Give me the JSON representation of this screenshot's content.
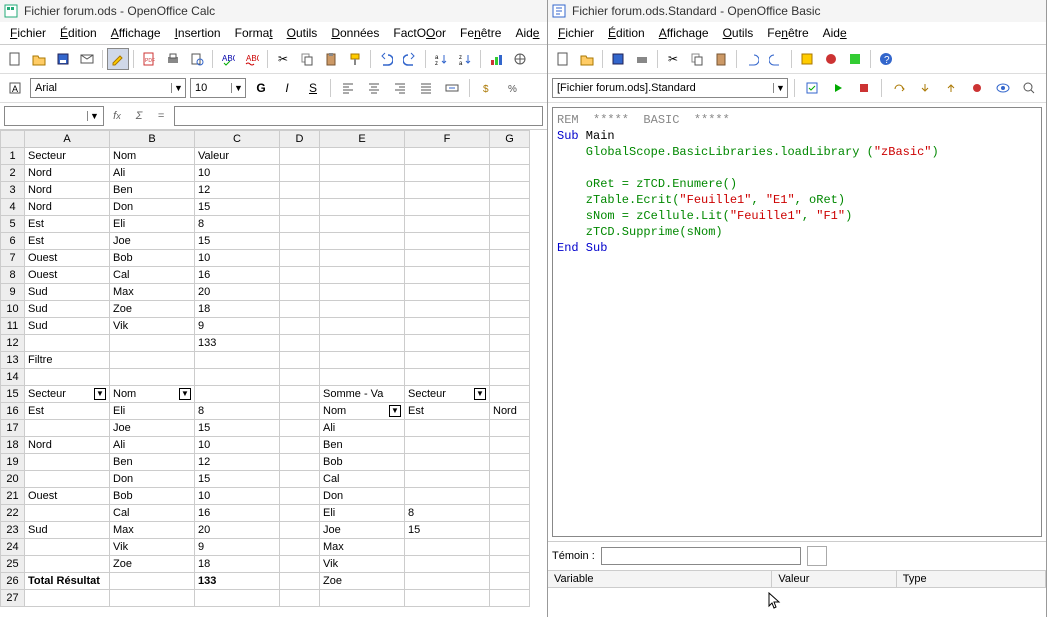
{
  "calc": {
    "title": "Fichier forum.ods - OpenOffice Calc",
    "menus": [
      "Fichier",
      "Édition",
      "Affichage",
      "Insertion",
      "Format",
      "Outils",
      "Données",
      "FactOOor",
      "Fenêtre",
      "Aide"
    ],
    "font_name": "Arial",
    "font_size": "10",
    "style_btns": {
      "bold": "G",
      "italic": "I",
      "underline": "S"
    },
    "cell_ref": "",
    "cols": [
      "A",
      "B",
      "C",
      "D",
      "E",
      "F",
      "G"
    ],
    "rows": [
      {
        "n": 1,
        "A": "Secteur",
        "B": "Nom",
        "C": "Valeur"
      },
      {
        "n": 2,
        "A": "Nord",
        "B": "Ali",
        "Cnum": "10"
      },
      {
        "n": 3,
        "A": "Nord",
        "B": "Ben",
        "Cnum": "12"
      },
      {
        "n": 4,
        "A": "Nord",
        "B": "Don",
        "Cnum": "15"
      },
      {
        "n": 5,
        "A": "Est",
        "B": "Eli",
        "Cnum": "8"
      },
      {
        "n": 6,
        "A": "Est",
        "B": "Joe",
        "Cnum": "15"
      },
      {
        "n": 7,
        "A": "Ouest",
        "B": "Bob",
        "Cnum": "10"
      },
      {
        "n": 8,
        "A": "Ouest",
        "B": "Cal",
        "Cnum": "16"
      },
      {
        "n": 9,
        "A": "Sud",
        "B": "Max",
        "Cnum": "20"
      },
      {
        "n": 10,
        "A": "Sud",
        "B": "Zoe",
        "Cnum": "18"
      },
      {
        "n": 11,
        "A": "Sud",
        "B": "Vik",
        "Cnum": "9"
      },
      {
        "n": 12,
        "Cnum": "133"
      },
      {
        "n": 13,
        "A": "Filtre"
      },
      {
        "n": 14
      },
      {
        "n": 15,
        "A": "Secteur",
        "Afilter": true,
        "B": "Nom",
        "Bfilter": true,
        "E": "Somme - Va",
        "F": "Secteur",
        "Ffilter": true,
        "borderEF": true
      },
      {
        "n": 16,
        "A": "Est",
        "B": "Eli",
        "Cnum": "8",
        "E": "Nom",
        "Efilter": true,
        "F": "Est",
        "G": "Nord",
        "borderEF": true
      },
      {
        "n": 17,
        "B": "Joe",
        "Cnum": "15",
        "E": "Ali",
        "borderEF": true
      },
      {
        "n": 18,
        "A": "Nord",
        "B": "Ali",
        "Cnum": "10",
        "E": "Ben",
        "borderEF": true
      },
      {
        "n": 19,
        "B": "Ben",
        "Cnum": "12",
        "E": "Bob",
        "borderEF": true
      },
      {
        "n": 20,
        "B": "Don",
        "Cnum": "15",
        "E": "Cal",
        "borderEF": true
      },
      {
        "n": 21,
        "A": "Ouest",
        "B": "Bob",
        "Cnum": "10",
        "E": "Don",
        "borderEF": true
      },
      {
        "n": 22,
        "B": "Cal",
        "Cnum": "16",
        "E": "Eli",
        "Fnum": "8",
        "borderEF": true
      },
      {
        "n": 23,
        "A": "Sud",
        "B": "Max",
        "Cnum": "20",
        "E": "Joe",
        "Fnum": "15",
        "borderEF": true
      },
      {
        "n": 24,
        "B": "Vik",
        "Cnum": "9",
        "E": "Max",
        "borderEF": true
      },
      {
        "n": 25,
        "B": "Zoe",
        "Cnum": "18",
        "E": "Vik",
        "borderEF": true
      },
      {
        "n": 26,
        "A": "Total Résultat",
        "Abold": true,
        "Cnum": "133",
        "Cbold": true,
        "E": "Zoe",
        "borderEF": true
      },
      {
        "n": 27
      }
    ]
  },
  "basic": {
    "title": "Fichier forum.ods.Standard - OpenOffice Basic",
    "menus": [
      "Fichier",
      "Édition",
      "Affichage",
      "Outils",
      "Fenêtre",
      "Aide"
    ],
    "module": "[Fichier forum.ods].Standard",
    "code_lines": [
      [
        {
          "t": "REM  *****  BASIC  *****",
          "c": "kw-rem"
        }
      ],
      [
        {
          "t": "Sub",
          "c": "kw-blue"
        },
        {
          "t": " Main"
        }
      ],
      [
        {
          "t": "    GlobalScope.BasicLibraries.loadLibrary (",
          "c": "kw-green"
        },
        {
          "t": "\"zBasic\"",
          "c": "kw-red"
        },
        {
          "t": ")",
          "c": "kw-green"
        }
      ],
      [
        {
          "t": ""
        }
      ],
      [
        {
          "t": "    oRet = zTCD.Enumere()",
          "c": "kw-green"
        }
      ],
      [
        {
          "t": "    zTable.Ecrit(",
          "c": "kw-green"
        },
        {
          "t": "\"Feuille1\"",
          "c": "kw-red"
        },
        {
          "t": ", ",
          "c": "kw-green"
        },
        {
          "t": "\"E1\"",
          "c": "kw-red"
        },
        {
          "t": ", oRet)",
          "c": "kw-green"
        }
      ],
      [
        {
          "t": "    sNom = zCellule.Lit(",
          "c": "kw-green"
        },
        {
          "t": "\"Feuille1\"",
          "c": "kw-red"
        },
        {
          "t": ", ",
          "c": "kw-green"
        },
        {
          "t": "\"F1\"",
          "c": "kw-red"
        },
        {
          "t": ")",
          "c": "kw-green"
        }
      ],
      [
        {
          "t": "    zTCD.Supprime(sNom)",
          "c": "kw-green"
        }
      ],
      [
        {
          "t": "End Sub",
          "c": "kw-blue"
        }
      ]
    ],
    "witness_label": "Témoin :",
    "var_headers": [
      "Variable",
      "Valeur",
      "Type"
    ]
  }
}
